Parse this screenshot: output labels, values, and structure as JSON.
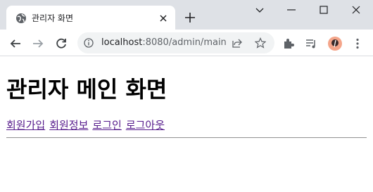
{
  "tab": {
    "title": "관리자 화면",
    "favicon": "globe-icon"
  },
  "toolbar": {
    "url_host": "localhost",
    "url_path": ":8080/admin/main"
  },
  "page": {
    "heading": "관리자 메인 화면",
    "links": [
      "회원가입",
      "회원정보",
      "로그인",
      "로그아웃"
    ]
  },
  "colors": {
    "tabstrip_bg": "#dee1e6",
    "omnibox_bg": "#f1f3f4",
    "visited_link": "#551a8b",
    "avatar_bg": "#f4a58a"
  }
}
